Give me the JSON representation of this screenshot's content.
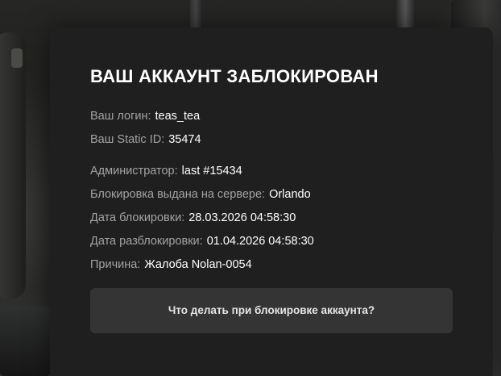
{
  "dialog": {
    "title": "ВАШ АККАУНТ ЗАБЛОКИРОВАН",
    "fields": [
      {
        "label": "Ваш логин:",
        "value": "teas_tea"
      },
      {
        "label": "Ваш Static ID:",
        "value": "35474"
      },
      {
        "label": "Администратор:",
        "value": "last #15434"
      },
      {
        "label": "Блокировка выдана на сервере:",
        "value": "Orlando"
      },
      {
        "label": "Дата блокировки:",
        "value": "28.03.2026 04:58:30"
      },
      {
        "label": "Дата разблокировки:",
        "value": "01.04.2026 04:58:30"
      },
      {
        "label": "Причина:",
        "value": "Жалоба Nolan-0054"
      }
    ],
    "help_button_label": "Что делать при блокировке аккаунта?"
  },
  "colors": {
    "panel_bg": "#1f1f1f",
    "label": "#a3a3a3",
    "value": "#ffffff",
    "button_bg": "#343434"
  }
}
